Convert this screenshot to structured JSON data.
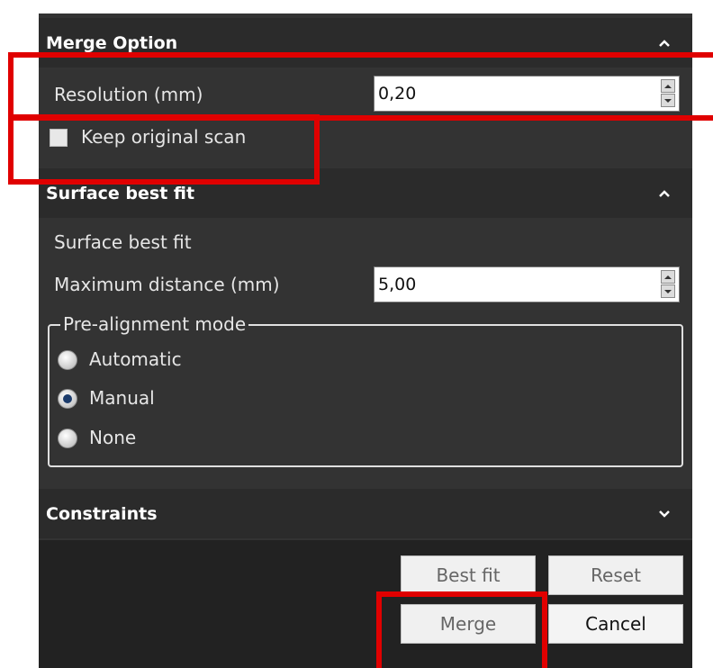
{
  "merge_option": {
    "title": "Merge Option",
    "resolution_label": "Resolution (mm)",
    "resolution_value": "0,20",
    "keep_scan_label": "Keep original scan",
    "keep_scan_checked": false
  },
  "surface_best_fit": {
    "title": "Surface best fit",
    "subtitle": "Surface best fit",
    "max_distance_label": "Maximum distance (mm)",
    "max_distance_value": "5,00",
    "prealign_legend": "Pre-alignment mode",
    "options": [
      "Automatic",
      "Manual",
      "None"
    ],
    "selected": "Manual"
  },
  "constraints": {
    "title": "Constraints"
  },
  "buttons": {
    "best_fit": "Best fit",
    "reset": "Reset",
    "merge": "Merge",
    "cancel": "Cancel"
  },
  "colors": {
    "panel": "#333333",
    "header": "#2b2b2b",
    "highlight": "#e00000"
  }
}
